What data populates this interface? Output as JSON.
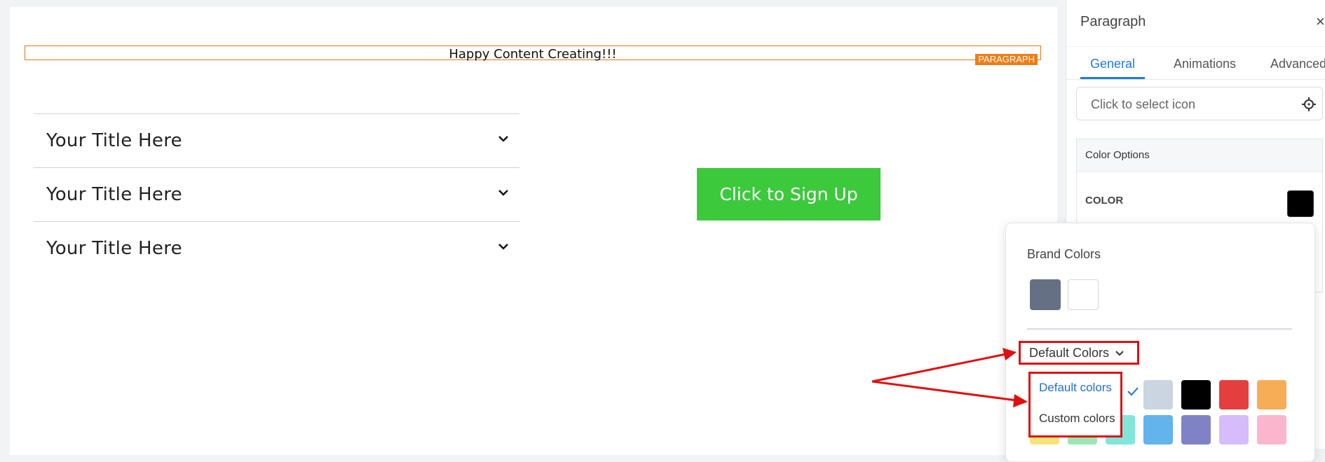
{
  "canvas": {
    "paragraph_text": "Happy Content Creating!!!",
    "paragraph_tag": "PARAGRAPH",
    "accordion": [
      {
        "title": "Your Title Here"
      },
      {
        "title": "Your Title Here"
      },
      {
        "title": "Your Title Here"
      }
    ],
    "cta_label": "Click to Sign Up"
  },
  "panel": {
    "title": "Paragraph",
    "close": "×",
    "tabs": [
      {
        "label": "General",
        "active": true
      },
      {
        "label": "Animations",
        "active": false
      },
      {
        "label": "Advanced",
        "active": false
      }
    ],
    "icon_select_placeholder": "Click to select icon",
    "color_options_label": "Color Options",
    "color_label": "COLOR",
    "color_value": "#000000"
  },
  "popover": {
    "brand_colors_label": "Brand Colors",
    "brand_colors": [
      "#667085",
      "#ffffff"
    ],
    "default_colors_label": "Default Colors",
    "dropdown": {
      "options": [
        {
          "label": "Default colors",
          "selected": true
        },
        {
          "label": "Custom colors",
          "selected": false
        }
      ]
    },
    "grid_colors_row1": [
      "#cbd5e1",
      "#000000",
      "#e53e3e",
      "#f6ad55"
    ],
    "grid_colors_row2": [
      "#f6e27a",
      "#9ae6b4",
      "#81e6d9",
      "#63b3ed",
      "#7f83c6",
      "#d6bcfa",
      "#fbb6ce"
    ]
  },
  "colors": {
    "accent_blue": "#1e7be0",
    "cta_green": "#3cc93c",
    "highlight_red": "#e01010",
    "paragraph_orange": "#ef7d16"
  }
}
